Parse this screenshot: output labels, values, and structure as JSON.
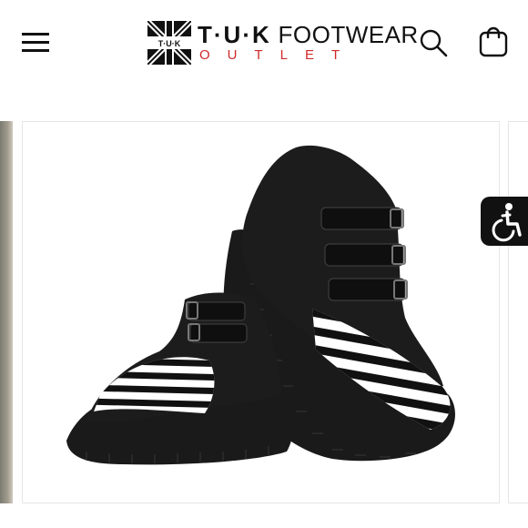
{
  "header": {
    "menu_icon": "hamburger-menu-icon",
    "logo": {
      "mark_text": "T·U·K",
      "brand_bold": "T·U·K",
      "brand_rest": "FOOTWEAR",
      "subtitle": "OUTLET",
      "subtitle_color": "#d22a2a"
    },
    "search_icon": "search-icon",
    "cart_icon": "shopping-bag-icon"
  },
  "product": {
    "image_icon": "creeper-boots-image",
    "stripe_colors": [
      "#111111",
      "#ffffff"
    ]
  },
  "accessibility": {
    "icon": "wheelchair-accessibility-icon",
    "color": "#111111"
  }
}
